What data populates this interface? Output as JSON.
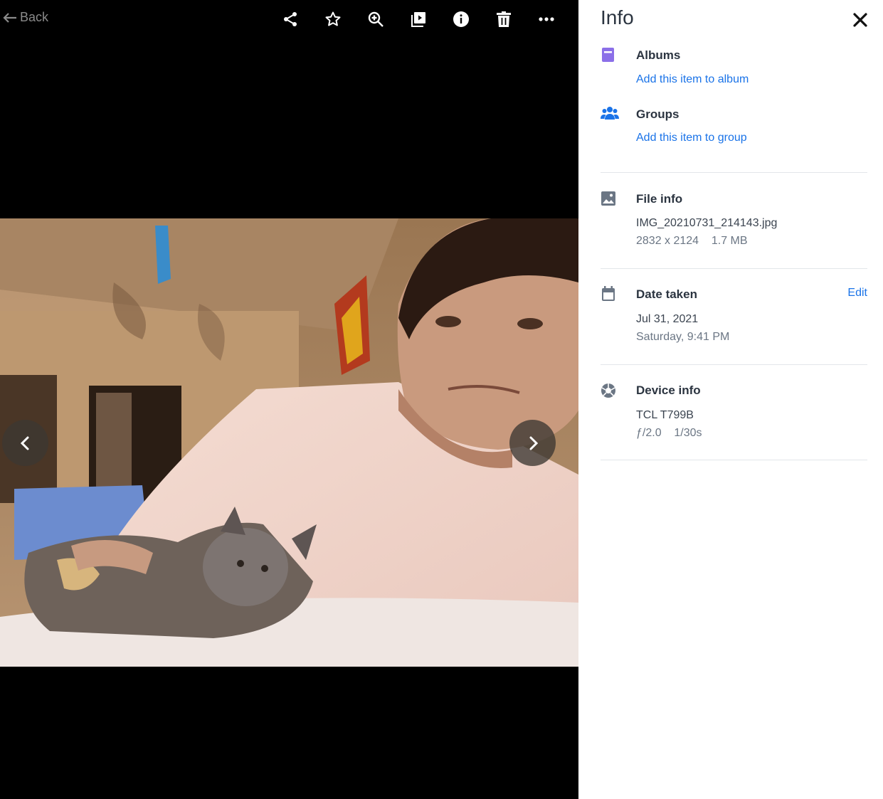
{
  "viewer": {
    "back_label": "Back",
    "toolbar": [
      {
        "icon": "share-icon"
      },
      {
        "icon": "star-icon"
      },
      {
        "icon": "zoom-in-icon"
      },
      {
        "icon": "slideshow-icon"
      },
      {
        "icon": "info-icon"
      },
      {
        "icon": "trash-icon"
      },
      {
        "icon": "more-icon"
      }
    ]
  },
  "panel": {
    "title": "Info",
    "albums": {
      "heading": "Albums",
      "action": "Add this item to album"
    },
    "groups": {
      "heading": "Groups",
      "action": "Add this item to group"
    },
    "file_info": {
      "heading": "File info",
      "filename": "IMG_20210731_214143.jpg",
      "dimensions": "2832 x 2124",
      "size": "1.7 MB"
    },
    "date_taken": {
      "heading": "Date taken",
      "edit_label": "Edit",
      "date": "Jul 31, 2021",
      "day_time": "Saturday, 9:41 PM"
    },
    "device_info": {
      "heading": "Device info",
      "model": "TCL T799B",
      "aperture": "ƒ/2.0",
      "shutter": "1/30s"
    }
  },
  "colors": {
    "accent": "#1a73e8",
    "album_icon": "#8b6fe8",
    "groups_icon": "#1a73e8",
    "icon_gray": "#6b7684"
  }
}
